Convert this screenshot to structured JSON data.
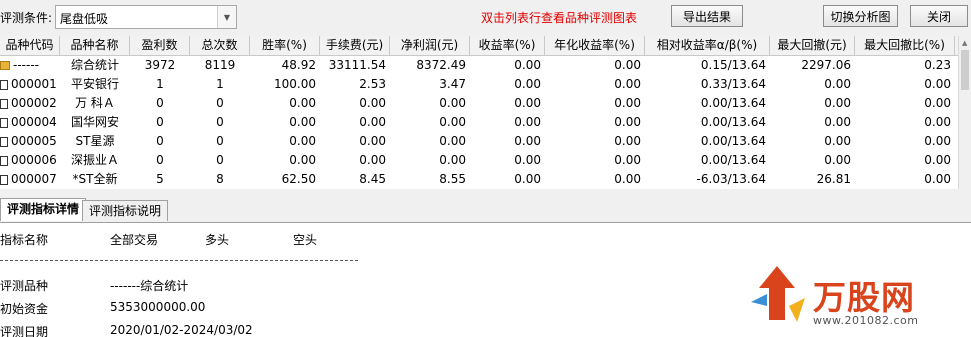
{
  "toolbar": {
    "condition_label": "评测条件:",
    "condition_value": "尾盘低吸",
    "hint": "双击列表行查看品种评测图表",
    "export_label": "导出结果",
    "switch_label": "切换分析图",
    "close_label": "关闭"
  },
  "table": {
    "headers": [
      "品种代码",
      "品种名称",
      "盈利数",
      "总次数",
      "胜率(%)",
      "手续费(元)",
      "净利润(元)",
      "收益率(%)",
      "年化收益率(%)",
      "相对收益率α/β(%)",
      "最大回撤(元)",
      "最大回撤比(%)"
    ],
    "rows": [
      {
        "icon": "folder-icon",
        "cells": [
          "------",
          "综合统计",
          "3972",
          "8119",
          "48.92",
          "33111.54",
          "8372.49",
          "0.00",
          "0.00",
          "0.15/13.64",
          "2297.06",
          "0.23"
        ]
      },
      {
        "icon": "document-icon",
        "cells": [
          "000001",
          "平安银行",
          "1",
          "1",
          "100.00",
          "2.53",
          "3.47",
          "0.00",
          "0.00",
          "0.33/13.64",
          "0.00",
          "0.00"
        ]
      },
      {
        "icon": "document-icon",
        "cells": [
          "000002",
          "万 科Ａ",
          "0",
          "0",
          "0.00",
          "0.00",
          "0.00",
          "0.00",
          "0.00",
          "0.00/13.64",
          "0.00",
          "0.00"
        ]
      },
      {
        "icon": "document-icon",
        "cells": [
          "000004",
          "国华网安",
          "0",
          "0",
          "0.00",
          "0.00",
          "0.00",
          "0.00",
          "0.00",
          "0.00/13.64",
          "0.00",
          "0.00"
        ]
      },
      {
        "icon": "document-icon",
        "cells": [
          "000005",
          "ST星源",
          "0",
          "0",
          "0.00",
          "0.00",
          "0.00",
          "0.00",
          "0.00",
          "0.00/13.64",
          "0.00",
          "0.00"
        ]
      },
      {
        "icon": "document-icon",
        "cells": [
          "000006",
          "深振业Ａ",
          "0",
          "0",
          "0.00",
          "0.00",
          "0.00",
          "0.00",
          "0.00",
          "0.00/13.64",
          "0.00",
          "0.00"
        ]
      },
      {
        "icon": "document-icon",
        "cells": [
          "000007",
          "*ST全新",
          "5",
          "8",
          "62.50",
          "8.45",
          "8.55",
          "0.00",
          "0.00",
          "-6.03/13.64",
          "26.81",
          "0.00"
        ]
      }
    ]
  },
  "tabs": [
    {
      "label": "评测指标详情",
      "active": true
    },
    {
      "label": "评测指标说明",
      "active": false
    }
  ],
  "detail": {
    "col_headers": [
      "指标名称",
      "全部交易",
      "多头",
      "空头"
    ],
    "items": [
      {
        "label": "评测品种",
        "value": "-------综合统计"
      },
      {
        "label": "初始资金",
        "value": "5353000000.00"
      },
      {
        "label": "评测日期",
        "value": "2020/01/02-2024/03/02"
      }
    ]
  },
  "watermark": {
    "title": "万股网",
    "url": "www.201082.com"
  },
  "colors": {
    "hint": "#e00000",
    "watermark": "#d9441c"
  }
}
